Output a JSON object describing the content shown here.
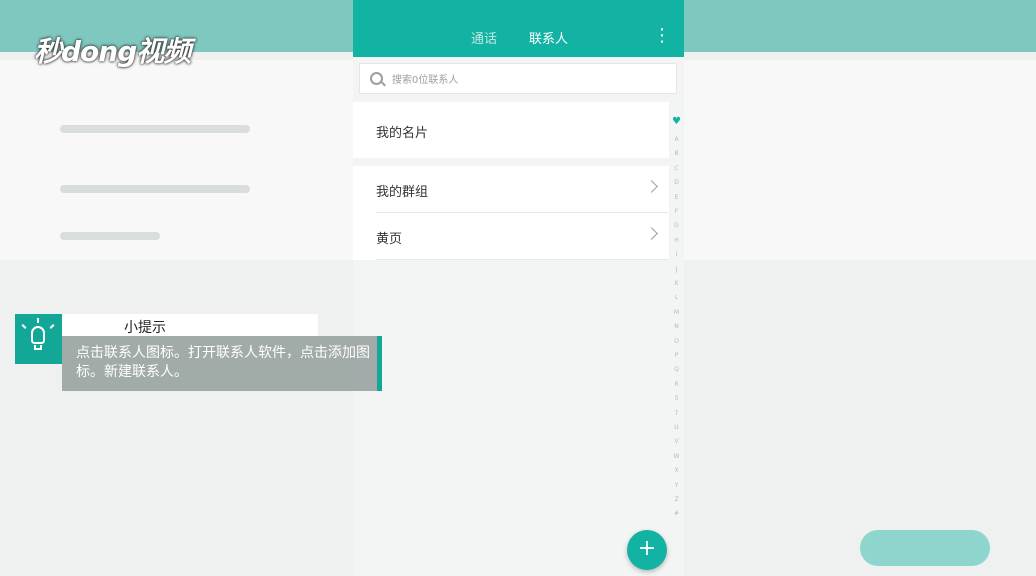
{
  "logo": {
    "text": "秒dong视频"
  },
  "header": {
    "tabs": [
      {
        "label": "通话",
        "active": false
      },
      {
        "label": "联系人",
        "active": true
      }
    ],
    "menu_icon": "more-vertical-icon"
  },
  "search": {
    "placeholder": "搜索0位联系人"
  },
  "list": {
    "my_card": "我的名片",
    "my_groups": "我的群组",
    "yellow_pages": "黄页"
  },
  "alphabet": [
    "A",
    "B",
    "C",
    "D",
    "E",
    "F",
    "G",
    "H",
    "I",
    "J",
    "K",
    "L",
    "M",
    "N",
    "O",
    "P",
    "Q",
    "R",
    "S",
    "T",
    "U",
    "V",
    "W",
    "X",
    "Y",
    "Z",
    "#"
  ],
  "fab": {
    "icon": "plus-icon",
    "label": "+"
  },
  "tip": {
    "title": "小提示",
    "text": "点击联系人图标。打开联系人软件，点击添加图标。新建联系人。"
  },
  "colors": {
    "accent": "#13b3a3",
    "tip_accent": "#13a798"
  }
}
